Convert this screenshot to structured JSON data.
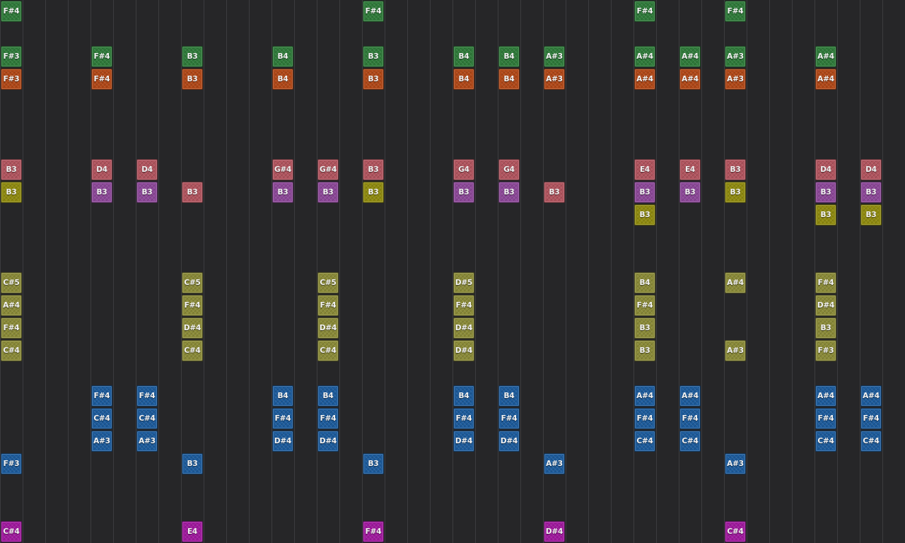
{
  "colors": {
    "background": "#262628",
    "gridline": "#3c3c3f",
    "green": "#2f7a3a",
    "orange": "#b04818",
    "salmon": "#b0545e",
    "yellow": "#8f8a10",
    "purple": "#8c4898",
    "olive": "#8a8a38",
    "blue": "#1d5b9b",
    "magenta": "#a01a9e"
  },
  "notes": [
    {
      "col": 0,
      "row": 0,
      "color": "green",
      "label": "F#4"
    },
    {
      "col": 16,
      "row": 0,
      "color": "green",
      "label": "F#4"
    },
    {
      "col": 28,
      "row": 0,
      "color": "green",
      "label": "F#4"
    },
    {
      "col": 32,
      "row": 0,
      "color": "green",
      "label": "F#4"
    },
    {
      "col": 0,
      "row": 2,
      "color": "green",
      "label": "F#3"
    },
    {
      "col": 4,
      "row": 2,
      "color": "green",
      "label": "F#4"
    },
    {
      "col": 8,
      "row": 2,
      "color": "green",
      "label": "B3"
    },
    {
      "col": 12,
      "row": 2,
      "color": "green",
      "label": "B4"
    },
    {
      "col": 16,
      "row": 2,
      "color": "green",
      "label": "B3"
    },
    {
      "col": 20,
      "row": 2,
      "color": "green",
      "label": "B4"
    },
    {
      "col": 22,
      "row": 2,
      "color": "green",
      "label": "B4"
    },
    {
      "col": 24,
      "row": 2,
      "color": "green",
      "label": "A#3"
    },
    {
      "col": 28,
      "row": 2,
      "color": "green",
      "label": "A#4"
    },
    {
      "col": 30,
      "row": 2,
      "color": "green",
      "label": "A#4"
    },
    {
      "col": 32,
      "row": 2,
      "color": "green",
      "label": "A#3"
    },
    {
      "col": 36,
      "row": 2,
      "color": "green",
      "label": "A#4"
    },
    {
      "col": 0,
      "row": 3,
      "color": "orange",
      "label": "F#3"
    },
    {
      "col": 4,
      "row": 3,
      "color": "orange",
      "label": "F#4"
    },
    {
      "col": 8,
      "row": 3,
      "color": "orange",
      "label": "B3"
    },
    {
      "col": 12,
      "row": 3,
      "color": "orange",
      "label": "B4"
    },
    {
      "col": 16,
      "row": 3,
      "color": "orange",
      "label": "B3"
    },
    {
      "col": 20,
      "row": 3,
      "color": "orange",
      "label": "B4"
    },
    {
      "col": 22,
      "row": 3,
      "color": "orange",
      "label": "B4"
    },
    {
      "col": 24,
      "row": 3,
      "color": "orange",
      "label": "A#3"
    },
    {
      "col": 28,
      "row": 3,
      "color": "orange",
      "label": "A#4"
    },
    {
      "col": 30,
      "row": 3,
      "color": "orange",
      "label": "A#4"
    },
    {
      "col": 32,
      "row": 3,
      "color": "orange",
      "label": "A#3"
    },
    {
      "col": 36,
      "row": 3,
      "color": "orange",
      "label": "A#4"
    },
    {
      "col": 0,
      "row": 7,
      "color": "salmon",
      "label": "B3"
    },
    {
      "col": 4,
      "row": 7,
      "color": "salmon",
      "label": "D4"
    },
    {
      "col": 6,
      "row": 7,
      "color": "salmon",
      "label": "D4"
    },
    {
      "col": 12,
      "row": 7,
      "color": "salmon",
      "label": "G#4"
    },
    {
      "col": 14,
      "row": 7,
      "color": "salmon",
      "label": "G#4"
    },
    {
      "col": 16,
      "row": 7,
      "color": "salmon",
      "label": "B3"
    },
    {
      "col": 20,
      "row": 7,
      "color": "salmon",
      "label": "G4"
    },
    {
      "col": 22,
      "row": 7,
      "color": "salmon",
      "label": "G4"
    },
    {
      "col": 28,
      "row": 7,
      "color": "salmon",
      "label": "E4"
    },
    {
      "col": 30,
      "row": 7,
      "color": "salmon",
      "label": "E4"
    },
    {
      "col": 32,
      "row": 7,
      "color": "salmon",
      "label": "B3"
    },
    {
      "col": 36,
      "row": 7,
      "color": "salmon",
      "label": "D4"
    },
    {
      "col": 38,
      "row": 7,
      "color": "salmon",
      "label": "D4"
    },
    {
      "col": 0,
      "row": 8,
      "color": "yellow",
      "label": "B3"
    },
    {
      "col": 4,
      "row": 8,
      "color": "purple",
      "label": "B3"
    },
    {
      "col": 6,
      "row": 8,
      "color": "purple",
      "label": "B3"
    },
    {
      "col": 8,
      "row": 8,
      "color": "salmon",
      "label": "B3"
    },
    {
      "col": 12,
      "row": 8,
      "color": "purple",
      "label": "B3"
    },
    {
      "col": 14,
      "row": 8,
      "color": "purple",
      "label": "B3"
    },
    {
      "col": 16,
      "row": 8,
      "color": "yellow",
      "label": "B3"
    },
    {
      "col": 20,
      "row": 8,
      "color": "purple",
      "label": "B3"
    },
    {
      "col": 22,
      "row": 8,
      "color": "purple",
      "label": "B3"
    },
    {
      "col": 24,
      "row": 8,
      "color": "salmon",
      "label": "B3"
    },
    {
      "col": 28,
      "row": 8,
      "color": "purple",
      "label": "B3"
    },
    {
      "col": 30,
      "row": 8,
      "color": "purple",
      "label": "B3"
    },
    {
      "col": 32,
      "row": 8,
      "color": "yellow",
      "label": "B3"
    },
    {
      "col": 36,
      "row": 8,
      "color": "purple",
      "label": "B3"
    },
    {
      "col": 38,
      "row": 8,
      "color": "purple",
      "label": "B3"
    },
    {
      "col": 28,
      "row": 9,
      "color": "yellow",
      "label": "B3"
    },
    {
      "col": 36,
      "row": 9,
      "color": "yellow",
      "label": "B3"
    },
    {
      "col": 38,
      "row": 9,
      "color": "yellow",
      "label": "B3"
    },
    {
      "col": 0,
      "row": 12,
      "color": "olive",
      "label": "C#5"
    },
    {
      "col": 8,
      "row": 12,
      "color": "olive",
      "label": "C#5"
    },
    {
      "col": 14,
      "row": 12,
      "color": "olive",
      "label": "C#5"
    },
    {
      "col": 20,
      "row": 12,
      "color": "olive",
      "label": "D#5"
    },
    {
      "col": 28,
      "row": 12,
      "color": "olive",
      "label": "B4"
    },
    {
      "col": 32,
      "row": 12,
      "color": "olive",
      "label": "A#4"
    },
    {
      "col": 36,
      "row": 12,
      "color": "olive",
      "label": "F#4"
    },
    {
      "col": 0,
      "row": 13,
      "color": "olive",
      "label": "A#4"
    },
    {
      "col": 8,
      "row": 13,
      "color": "olive",
      "label": "F#4"
    },
    {
      "col": 14,
      "row": 13,
      "color": "olive",
      "label": "F#4"
    },
    {
      "col": 20,
      "row": 13,
      "color": "olive",
      "label": "F#4"
    },
    {
      "col": 28,
      "row": 13,
      "color": "olive",
      "label": "F#4"
    },
    {
      "col": 36,
      "row": 13,
      "color": "olive",
      "label": "D#4"
    },
    {
      "col": 0,
      "row": 14,
      "color": "olive",
      "label": "F#4"
    },
    {
      "col": 8,
      "row": 14,
      "color": "olive",
      "label": "D#4"
    },
    {
      "col": 14,
      "row": 14,
      "color": "olive",
      "label": "D#4"
    },
    {
      "col": 20,
      "row": 14,
      "color": "olive",
      "label": "D#4"
    },
    {
      "col": 28,
      "row": 14,
      "color": "olive",
      "label": "B3"
    },
    {
      "col": 36,
      "row": 14,
      "color": "olive",
      "label": "B3"
    },
    {
      "col": 0,
      "row": 15,
      "color": "olive",
      "label": "C#4"
    },
    {
      "col": 8,
      "row": 15,
      "color": "olive",
      "label": "C#4"
    },
    {
      "col": 14,
      "row": 15,
      "color": "olive",
      "label": "C#4"
    },
    {
      "col": 20,
      "row": 15,
      "color": "olive",
      "label": "D#4"
    },
    {
      "col": 28,
      "row": 15,
      "color": "olive",
      "label": "B3"
    },
    {
      "col": 32,
      "row": 15,
      "color": "olive",
      "label": "A#3"
    },
    {
      "col": 36,
      "row": 15,
      "color": "olive",
      "label": "F#3"
    },
    {
      "col": 4,
      "row": 17,
      "color": "blue",
      "label": "F#4"
    },
    {
      "col": 6,
      "row": 17,
      "color": "blue",
      "label": "F#4"
    },
    {
      "col": 12,
      "row": 17,
      "color": "blue",
      "label": "B4"
    },
    {
      "col": 14,
      "row": 17,
      "color": "blue",
      "label": "B4"
    },
    {
      "col": 20,
      "row": 17,
      "color": "blue",
      "label": "B4"
    },
    {
      "col": 22,
      "row": 17,
      "color": "blue",
      "label": "B4"
    },
    {
      "col": 28,
      "row": 17,
      "color": "blue",
      "label": "A#4"
    },
    {
      "col": 30,
      "row": 17,
      "color": "blue",
      "label": "A#4"
    },
    {
      "col": 36,
      "row": 17,
      "color": "blue",
      "label": "A#4"
    },
    {
      "col": 38,
      "row": 17,
      "color": "blue",
      "label": "A#4"
    },
    {
      "col": 4,
      "row": 18,
      "color": "blue",
      "label": "C#4"
    },
    {
      "col": 6,
      "row": 18,
      "color": "blue",
      "label": "C#4"
    },
    {
      "col": 12,
      "row": 18,
      "color": "blue",
      "label": "F#4"
    },
    {
      "col": 14,
      "row": 18,
      "color": "blue",
      "label": "F#4"
    },
    {
      "col": 20,
      "row": 18,
      "color": "blue",
      "label": "F#4"
    },
    {
      "col": 22,
      "row": 18,
      "color": "blue",
      "label": "F#4"
    },
    {
      "col": 28,
      "row": 18,
      "color": "blue",
      "label": "F#4"
    },
    {
      "col": 30,
      "row": 18,
      "color": "blue",
      "label": "F#4"
    },
    {
      "col": 36,
      "row": 18,
      "color": "blue",
      "label": "F#4"
    },
    {
      "col": 38,
      "row": 18,
      "color": "blue",
      "label": "F#4"
    },
    {
      "col": 4,
      "row": 19,
      "color": "blue",
      "label": "A#3"
    },
    {
      "col": 6,
      "row": 19,
      "color": "blue",
      "label": "A#3"
    },
    {
      "col": 12,
      "row": 19,
      "color": "blue",
      "label": "D#4"
    },
    {
      "col": 14,
      "row": 19,
      "color": "blue",
      "label": "D#4"
    },
    {
      "col": 20,
      "row": 19,
      "color": "blue",
      "label": "D#4"
    },
    {
      "col": 22,
      "row": 19,
      "color": "blue",
      "label": "D#4"
    },
    {
      "col": 28,
      "row": 19,
      "color": "blue",
      "label": "C#4"
    },
    {
      "col": 30,
      "row": 19,
      "color": "blue",
      "label": "C#4"
    },
    {
      "col": 36,
      "row": 19,
      "color": "blue",
      "label": "C#4"
    },
    {
      "col": 38,
      "row": 19,
      "color": "blue",
      "label": "C#4"
    },
    {
      "col": 0,
      "row": 20,
      "color": "blue",
      "label": "F#3"
    },
    {
      "col": 8,
      "row": 20,
      "color": "blue",
      "label": "B3"
    },
    {
      "col": 16,
      "row": 20,
      "color": "blue",
      "label": "B3"
    },
    {
      "col": 24,
      "row": 20,
      "color": "blue",
      "label": "A#3"
    },
    {
      "col": 32,
      "row": 20,
      "color": "blue",
      "label": "A#3"
    },
    {
      "col": 0,
      "row": 23,
      "color": "magenta",
      "label": "C#4"
    },
    {
      "col": 8,
      "row": 23,
      "color": "magenta",
      "label": "E4"
    },
    {
      "col": 16,
      "row": 23,
      "color": "magenta",
      "label": "F#4"
    },
    {
      "col": 24,
      "row": 23,
      "color": "magenta",
      "label": "D#4"
    },
    {
      "col": 32,
      "row": 23,
      "color": "magenta",
      "label": "C#4"
    }
  ]
}
